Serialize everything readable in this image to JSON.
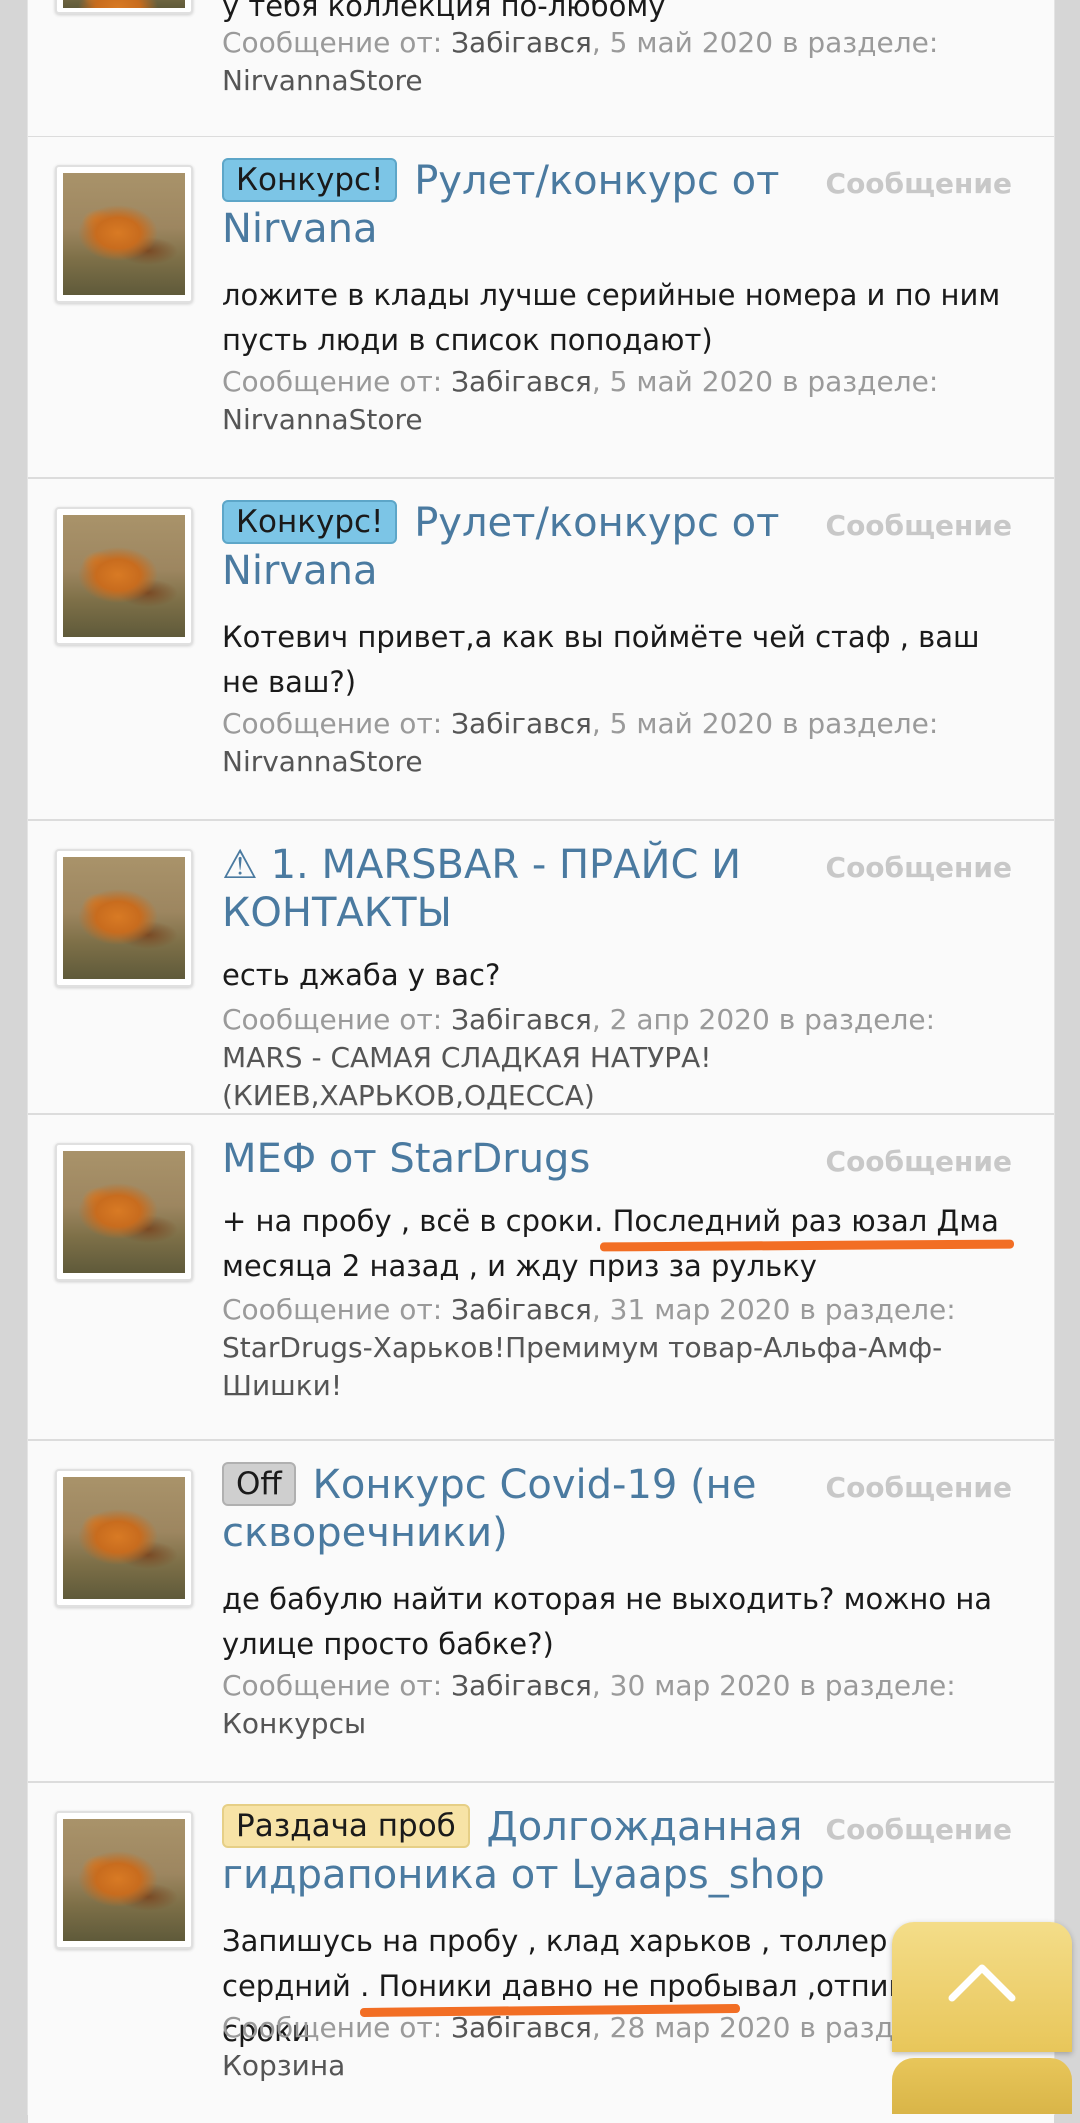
{
  "type_label": "Сообщение",
  "meta_prefix": "Сообщение от:",
  "meta_section": "в разделе:",
  "top_partial": {
    "snippet": "у тебя коллекция по-любому",
    "author": "Забігався",
    "date": "5 май 2020",
    "forum": "NirvannaStore"
  },
  "items": [
    {
      "prefix": "Конкурс!",
      "title": "Рулет/конкурс от Nirvana",
      "snippet": "ложите в клады лучше серийные номера и по ним пусть люди в список поподают)",
      "author": "Забігався",
      "date": "5 май 2020",
      "forum": "NirvannaStore"
    },
    {
      "prefix": "Конкурс!",
      "title": "Рулет/конкурс от Nirvana",
      "snippet": "Котевич привет,а как вы поймёте чей стаф , ваш не ваш?)",
      "author": "Забігався",
      "date": "5 май 2020",
      "forum": "NirvannaStore"
    },
    {
      "title": "⚠ 1. MARSBAR - ПРАЙС И КОНТАКТЫ",
      "snippet": "есть джаба у вас?",
      "author": "Забігався",
      "date": "2 апр 2020",
      "forum": "MARS - САМАЯ СЛАДКАЯ НАТУРА! (КИЕВ,ХАРЬКОВ,ОДЕССА)"
    },
    {
      "title": "МЕФ от StarDrugs",
      "snippet": "+ на пробу , всё в сроки. Последний раз юзал Дма месяца 2 назад , и жду приз за рульку",
      "author": "Забігався",
      "date": "31 мар 2020",
      "forum": "StarDrugs-Харьков!Премимум товар-Альфа-Амф-Шишки!"
    },
    {
      "prefix": "Off",
      "title": "Конкурс Covid-19 (не скворечники)",
      "snippet": "де бабулю найти которая не выходить? можно на улице просто бабке?)",
      "author": "Забігався",
      "date": "30 мар 2020",
      "forum": "Конкурсы"
    },
    {
      "prefix": "Раздача проб",
      "title": "Долгожданная гидрапоника от Lyaaps_shop",
      "snippet": "Запишусь на пробу , клад харьков , толлер сердний . Поники давно не пробывал ,отпишу в сроки",
      "author": "Забігався",
      "date": "28 мар 2020",
      "forum": "Корзина"
    }
  ],
  "colors": {
    "title": "#4a7aa0",
    "prefix_contest": "#7cc5e6",
    "prefix_off": "#cfcfcf",
    "prefix_samples": "#f7e3a6",
    "annotation": "#f26e24",
    "scroll_button": "#f4dd89"
  },
  "icons": {
    "scroll_top": "chevron-up-icon"
  }
}
